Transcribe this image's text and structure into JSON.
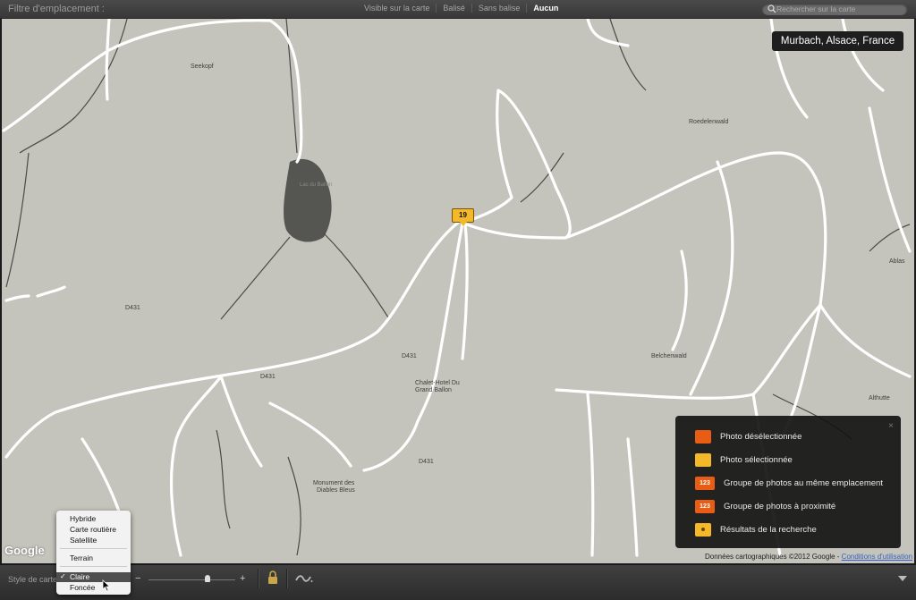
{
  "topbar": {
    "filter_label": "Filtre d'emplacement :",
    "filters": [
      {
        "label": "Visible sur la carte",
        "active": false
      },
      {
        "label": "Balisé",
        "active": false
      },
      {
        "label": "Sans balise",
        "active": false
      },
      {
        "label": "Aucun",
        "active": true
      }
    ],
    "search_placeholder": "Rechercher sur la carte"
  },
  "map": {
    "location": "Murbach, Alsace, France",
    "marker_count": "19",
    "labels": {
      "seekopf": "Seekopf",
      "lac": "Lac du Ballon",
      "roedelen": "Roedelenwald",
      "ablas": "Ablas",
      "d431_a": "D431",
      "d431_b": "D431",
      "d431_c": "D431",
      "d431_d": "D431",
      "belchen": "Belchenwald",
      "althutte": "Althutte",
      "chalet1": "Chalet-Hotel Du",
      "chalet2": "Grand Ballon",
      "monument1": "Monument des",
      "monument2": "Diables Bleus"
    },
    "google": "Google",
    "copyright": "Données cartographiques ©2012 Google -",
    "terms": "Conditions d'utilisation"
  },
  "legend": {
    "items": [
      {
        "label": "Photo désélectionnée",
        "icon": "orange-marker-icon",
        "color": "#e85d13"
      },
      {
        "label": "Photo sélectionnée",
        "icon": "yellow-marker-icon",
        "color": "#f4b92a"
      },
      {
        "label": "Groupe de photos au même emplacement",
        "icon": "cluster-same-icon",
        "badge": "123"
      },
      {
        "label": "Groupe de photos à proximité",
        "icon": "cluster-near-icon",
        "badge": "123"
      },
      {
        "label": "Résultats de la recherche",
        "icon": "search-result-icon"
      }
    ],
    "close": "×"
  },
  "bottombar": {
    "style_label": "Style de carte",
    "zoom_minus": "−",
    "zoom_plus": "+",
    "zoom_level": 0.68
  },
  "dropdown": {
    "items": [
      "Hybride",
      "Carte routière",
      "Satellite",
      "Terrain",
      "Claire",
      "Foncée"
    ],
    "selected": "Claire",
    "check": "✓"
  }
}
